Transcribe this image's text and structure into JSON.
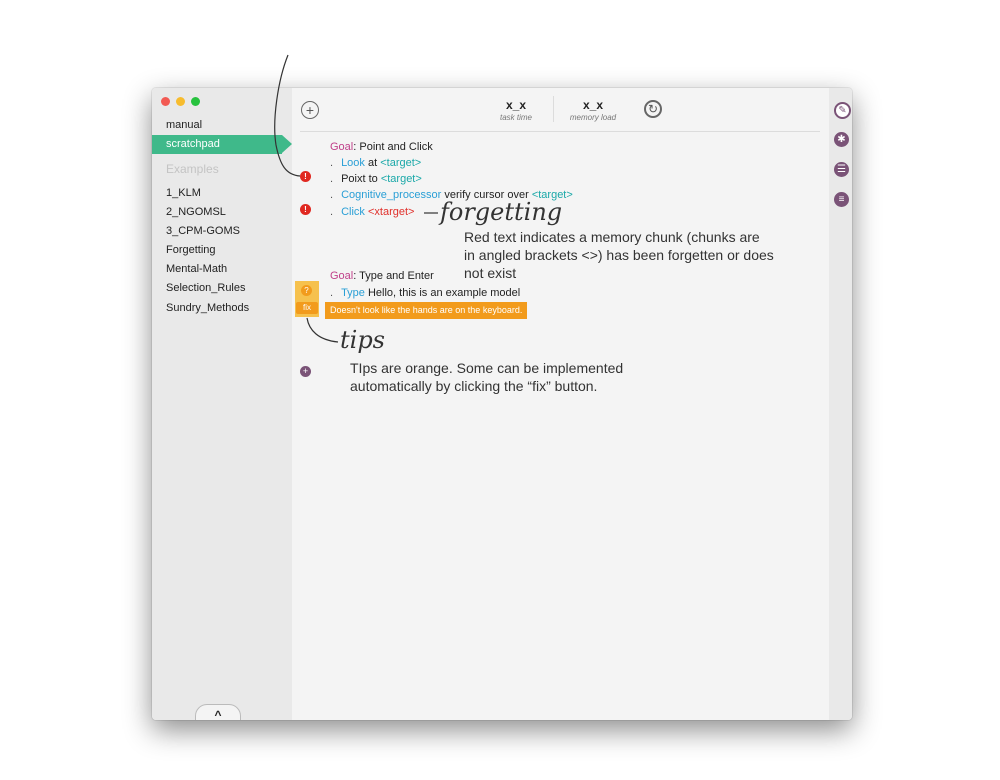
{
  "sidebar": {
    "items": [
      {
        "label": "manual"
      },
      {
        "label": "scratchpad"
      }
    ],
    "examples_header": "Examples",
    "examples": [
      {
        "label": "1_KLM"
      },
      {
        "label": "2_NGOMSL"
      },
      {
        "label": "3_CPM-GOMS"
      },
      {
        "label": "Forgetting"
      },
      {
        "label": "Mental-Math"
      },
      {
        "label": "Selection_Rules"
      },
      {
        "label": "Sundry_Methods"
      }
    ],
    "collapse_label": "^"
  },
  "toolbar": {
    "task_time_value": "x_x",
    "task_time_label": "task time",
    "memory_load_value": "x_x",
    "memory_load_label": "memory load"
  },
  "editor": {
    "block1": {
      "goal_kw": "Goal",
      "goal_text": ": Point and Click",
      "line1_op": "Look",
      "line1_rest": " at ",
      "line1_arg": "<target>",
      "line2_op": "Poixt to ",
      "line2_arg": "<target>",
      "line3_op": "Cognitive_processor",
      "line3_rest": " verify cursor over ",
      "line3_arg": "<target>",
      "line4_op": "Click",
      "line4_arg": "<xtarget>"
    },
    "block2": {
      "goal_kw": "Goal",
      "goal_text": ": Type and Enter",
      "line1_op": "Type",
      "line1_rest": " Hello, this is an example model"
    },
    "tip_message": "Doesn't look like the hands are on the keyboard.",
    "fix_label": "fix",
    "dot": "."
  },
  "annotations": {
    "forgetting_title": "forgetting",
    "forgetting_text": "Red text indicates a memory chunk (chunks are in angled brackets <>) has been forgetten or does not exist",
    "tips_title": "tips",
    "tips_text": "TIps are orange.  Some can be implemented automatically by clicking the “fix” button."
  },
  "colors": {
    "accent_green": "#3fb98a",
    "goal_pink": "#c0408a",
    "operator_blue": "#2a9fd6",
    "chunk_teal": "#1aa8a8",
    "error_red": "#e0302b",
    "tip_orange": "#f29b1c",
    "icon_purple": "#7a5377"
  }
}
